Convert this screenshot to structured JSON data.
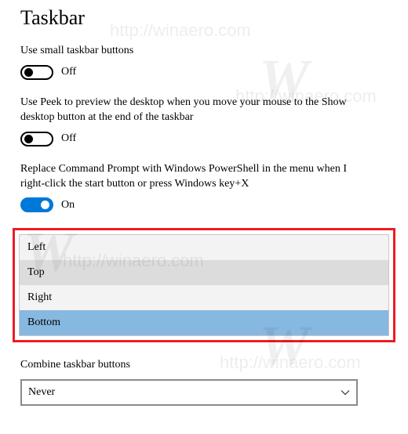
{
  "title": "Taskbar",
  "watermark_text": "http://winaero.com",
  "watermark_logo": "W",
  "settings": {
    "small_buttons": {
      "label": "Use small taskbar buttons",
      "state": "Off"
    },
    "use_peek": {
      "label": "Use Peek to preview the desktop when you move your mouse to the Show desktop button at the end of the taskbar",
      "state": "Off"
    },
    "powershell": {
      "label": "Replace Command Prompt with Windows PowerShell in the menu when I right-click the start button or press Windows key+X",
      "state": "On"
    }
  },
  "location_dropdown": {
    "items": [
      "Left",
      "Top",
      "Right",
      "Bottom"
    ],
    "hovered_index": 1,
    "selected_index": 3
  },
  "combine": {
    "label": "Combine taskbar buttons",
    "value": "Never"
  }
}
